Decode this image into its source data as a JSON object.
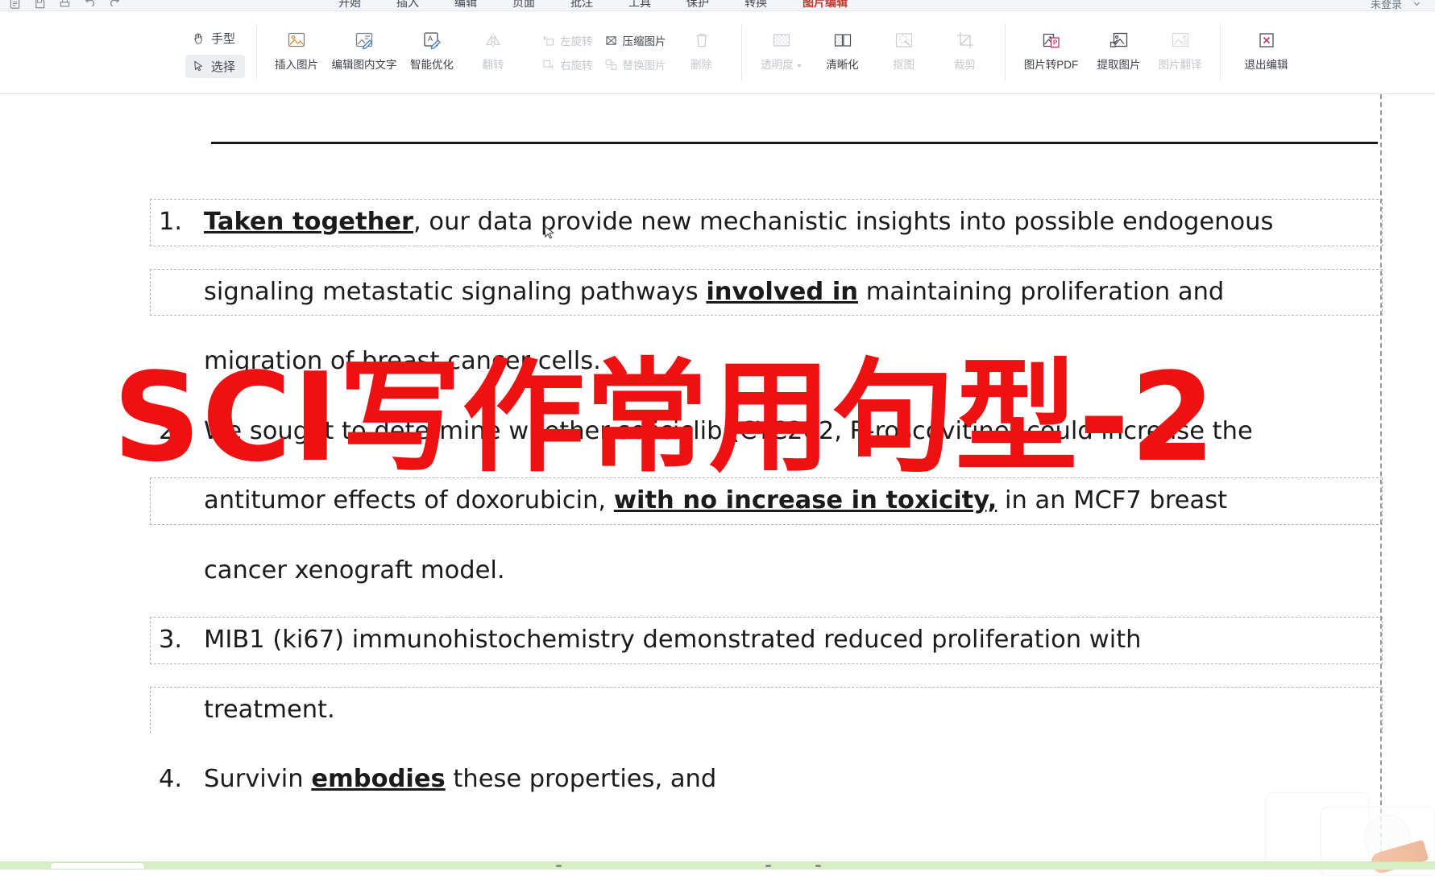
{
  "app": {
    "menu_tabs": [
      {
        "label": "开始",
        "active": false
      },
      {
        "label": "插入",
        "active": false
      },
      {
        "label": "编辑",
        "active": false
      },
      {
        "label": "页面",
        "active": false
      },
      {
        "label": "批注",
        "active": false
      },
      {
        "label": "工具",
        "active": false
      },
      {
        "label": "保护",
        "active": false
      },
      {
        "label": "转换",
        "active": false
      },
      {
        "label": "图片编辑",
        "active": true
      }
    ],
    "menu_right": [
      "未登录"
    ]
  },
  "ribbon": {
    "mode_group": [
      {
        "label": "手型",
        "icon": "hand-icon",
        "selected": false
      },
      {
        "label": "选择",
        "icon": "cursor-arrow-icon",
        "selected": true
      }
    ],
    "groups": [
      {
        "name": "image-ops",
        "buttons": [
          {
            "label": "插入图片",
            "icon": "insert-image-icon",
            "disabled": false,
            "dropdown": false
          },
          {
            "label": "编辑图内文字",
            "icon": "edit-image-text-icon",
            "disabled": false,
            "dropdown": false,
            "wide": true
          },
          {
            "label": "智能优化",
            "icon": "smart-optimize-icon",
            "disabled": false,
            "dropdown": false
          },
          {
            "label": "翻转",
            "icon": "flip-icon",
            "disabled": true,
            "dropdown": false
          }
        ]
      },
      {
        "name": "rotate-replace",
        "buttons": [
          {
            "label": "左旋转",
            "icon": "rotate-left-icon",
            "disabled": true,
            "inline": true
          },
          {
            "label": "右旋转",
            "icon": "rotate-right-icon",
            "disabled": true,
            "inline": true
          },
          {
            "label": "压缩图片",
            "icon": "compress-image-icon",
            "disabled": false,
            "inline": true
          },
          {
            "label": "替换图片",
            "icon": "replace-image-icon",
            "disabled": true,
            "inline": true
          },
          {
            "label": "删除",
            "icon": "trash-icon",
            "disabled": true
          }
        ]
      },
      {
        "name": "adjust",
        "buttons": [
          {
            "label": "透明度",
            "icon": "transparency-icon",
            "disabled": true,
            "dropdown": true
          },
          {
            "label": "清晰化",
            "icon": "sharpen-icon",
            "disabled": false,
            "dropdown": false
          },
          {
            "label": "抠图",
            "icon": "cutout-icon",
            "disabled": true,
            "dropdown": false
          },
          {
            "label": "裁剪",
            "icon": "crop-icon",
            "disabled": true,
            "dropdown": false
          }
        ]
      },
      {
        "name": "convert",
        "buttons": [
          {
            "label": "图片转PDF",
            "icon": "image-to-pdf-icon",
            "disabled": false,
            "wide": true
          },
          {
            "label": "提取图片",
            "icon": "extract-image-icon",
            "disabled": false
          },
          {
            "label": "图片翻译",
            "icon": "image-translate-icon",
            "disabled": true
          }
        ]
      },
      {
        "name": "exit",
        "buttons": [
          {
            "label": "退出编辑",
            "icon": "exit-edit-icon",
            "disabled": false
          }
        ]
      }
    ]
  },
  "document": {
    "watermark": "SCI写作常用句型-2",
    "watermark_color": "#ee1111",
    "paragraphs": [
      {
        "num": "1.",
        "runs": [
          {
            "text": "Taken together",
            "bold": true
          },
          {
            "text": ", our data provide new mechanistic insights into possible endogenous",
            "bold": false
          }
        ]
      },
      {
        "num": "",
        "runs": [
          {
            "text": "signaling  metastatic  signaling  pathways  ",
            "bold": false
          },
          {
            "text": "involved in",
            "bold": true
          },
          {
            "text": "  maintaining  proliferation  and",
            "bold": false
          }
        ]
      },
      {
        "num": "",
        "runs": [
          {
            "text": "migration of breast cancer cells.",
            "bold": false
          }
        ]
      },
      {
        "num": "2.",
        "runs": [
          {
            "text": "We sought to determine whether seliciclib (CYC202, R-roscovitine) could increase the",
            "bold": false
          }
        ]
      },
      {
        "num": "",
        "runs": [
          {
            "text": "antitumor  effects  of  doxorubicin,  ",
            "bold": false
          },
          {
            "text": "with no increase in toxicity,",
            "bold": true
          },
          {
            "text": "  in  an  MCF7  breast",
            "bold": false
          }
        ]
      },
      {
        "num": "",
        "runs": [
          {
            "text": "cancer xenograft model.",
            "bold": false
          }
        ]
      },
      {
        "num": "3.",
        "runs": [
          {
            "text": "MIB1  (ki67)  immunohistochemistry  demonstrated  reduced  proliferation  with",
            "bold": false
          }
        ]
      },
      {
        "num": "",
        "runs": [
          {
            "text": "treatment.",
            "bold": false
          }
        ]
      },
      {
        "num": "4.",
        "runs": [
          {
            "text": "Survivin ",
            "bold": false
          },
          {
            "text": "embodies",
            "bold": true
          },
          {
            "text": " these properties, and",
            "bold": false
          }
        ]
      }
    ]
  },
  "colors": {
    "accent_red": "#c23b32",
    "watermark_red": "#ee1111",
    "ribbon_bg": "#ffffff",
    "menubar_bg": "#f3f5f7",
    "statusbar_green": "#d6efc4"
  }
}
